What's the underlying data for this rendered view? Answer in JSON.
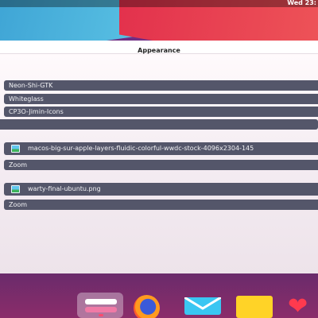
{
  "topbar": {
    "clock": "Wed 23:"
  },
  "window": {
    "title": "Appearance"
  },
  "appearance": {
    "gtk_theme": "Neon-Shi-GTK",
    "cursor_theme": "Whiteglass",
    "icon_theme": "CP3O-Jimin-Icons",
    "extra_field": "",
    "background_file": "macos-big-sur-apple-layers-fluidic-colorful-wwdc-stock-4096x2304-145",
    "background_mode": "Zoom",
    "lockscreen_file": "warty-final-ubuntu.png",
    "lockscreen_mode": "Zoom"
  },
  "dock": {
    "apps": [
      "settings-icon",
      "firefox-icon",
      "mail-icon",
      "files-icon",
      "favorites-icon"
    ],
    "active": "settings-icon"
  },
  "colors": {
    "panel_bg": "#54566a",
    "window_bg": "#f9f2f6",
    "accent": "#ff4a6e"
  }
}
